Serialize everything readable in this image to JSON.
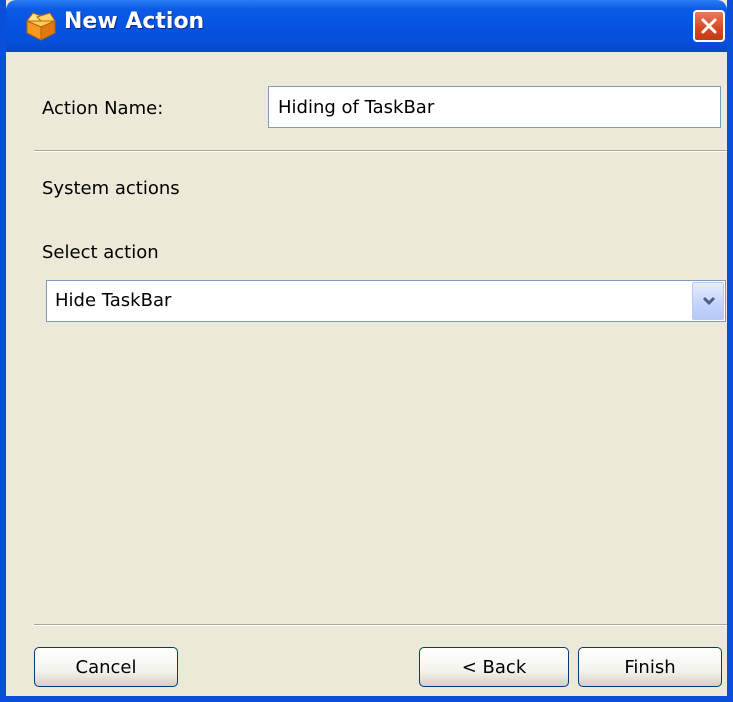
{
  "window": {
    "title": "New Action",
    "icon": "orange-box-icon",
    "close_icon": "close-x-icon",
    "accent_color": "#0553e0"
  },
  "form": {
    "action_name_label": "Action Name:",
    "action_name_value": "Hiding of TaskBar",
    "section_title": "System actions",
    "select_label": "Select action",
    "select_value": "Hide TaskBar",
    "select_arrow_icon": "chevron-down-icon"
  },
  "buttons": {
    "cancel": "Cancel",
    "back": "< Back",
    "finish": "Finish"
  }
}
